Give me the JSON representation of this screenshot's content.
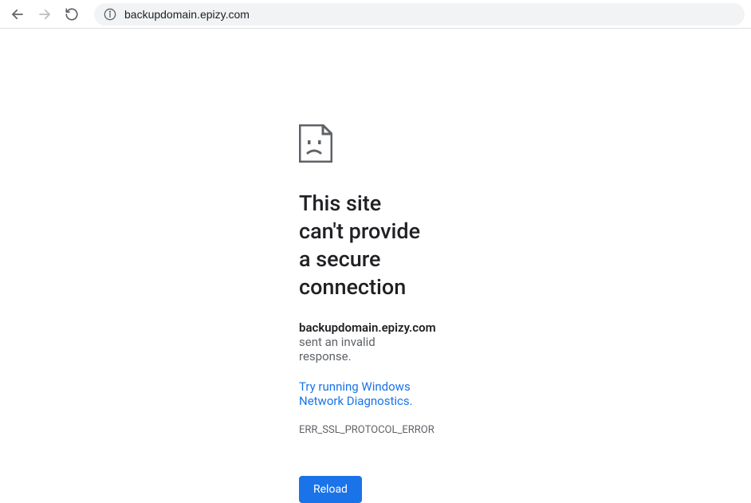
{
  "toolbar": {
    "url": "backupdomain.epizy.com"
  },
  "error": {
    "title": "This site can't provide a secure connection",
    "domain": "backupdomain.epizy.com",
    "message_suffix": " sent an invalid response.",
    "diagnostic_link": "Try running Windows Network Diagnostics.",
    "code": "ERR_SSL_PROTOCOL_ERROR",
    "reload_label": "Reload"
  }
}
